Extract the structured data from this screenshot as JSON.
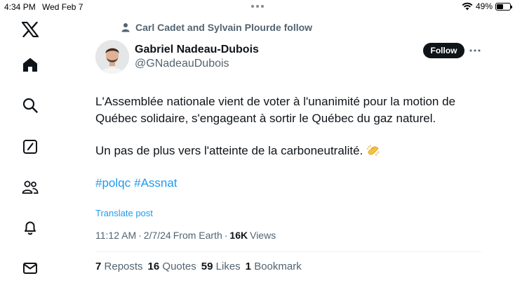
{
  "status_bar": {
    "time": "4:34 PM",
    "date": "Wed Feb 7",
    "battery": "49%",
    "battery_level": 0.49
  },
  "sidebar": {
    "items": [
      {
        "icon": "x-logo-icon"
      },
      {
        "icon": "home-icon"
      },
      {
        "icon": "search-icon"
      },
      {
        "icon": "compose-icon"
      },
      {
        "icon": "communities-icon"
      },
      {
        "icon": "notifications-icon"
      },
      {
        "icon": "messages-icon"
      }
    ]
  },
  "social_context": {
    "text": "Carl Cadet and Sylvain Plourde follow"
  },
  "author": {
    "name": "Gabriel Nadeau-Dubois",
    "handle": "@GNadeauDubois"
  },
  "follow_button": {
    "label": "Follow"
  },
  "tweet": {
    "text": "L'Assemblée nationale vient de voter à l'unanimité pour la motion de Québec solidaire, s'engageant à sortir le Québec du gaz naturel.",
    "text_2": "Un pas de plus vers l'atteinte de la carboneutralité.",
    "emoji": "clapping-hands-icon",
    "hashtags": [
      "#polqc",
      "#Assnat"
    ],
    "translate_label": "Translate post",
    "time": "11:12 AM",
    "date": "2/7/24",
    "source": "From Earth",
    "views_count": "16K",
    "views_label": "Views"
  },
  "stats": {
    "reposts_count": "7",
    "reposts_label": "Reposts",
    "quotes_count": "16",
    "quotes_label": "Quotes",
    "likes_count": "59",
    "likes_label": "Likes",
    "bookmarks_count": "1",
    "bookmarks_label": "Bookmark"
  },
  "colors": {
    "link": "#1d9bf0",
    "text_primary": "#0f1419",
    "text_secondary": "#536471"
  }
}
